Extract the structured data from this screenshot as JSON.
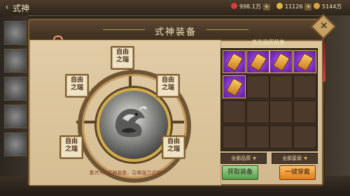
{
  "topbar": {
    "back_icon": "back-arrow-icon",
    "title": "式神",
    "resources": [
      {
        "icon": "jade-icon",
        "color": "#d83b3b",
        "value": "998.1万"
      },
      {
        "icon": "coin-icon",
        "color": "#e2b53a",
        "value": "11126"
      },
      {
        "icon": "stamina-icon",
        "color": "#d9a23b",
        "value": "5144万"
      }
    ]
  },
  "panel": {
    "title": "式神装备",
    "close_icon": "close-icon",
    "slots": [
      {
        "name": "slot-top",
        "label": "自由\n之瑞"
      },
      {
        "name": "slot-upper-left",
        "label": "自由\n之瑞"
      },
      {
        "name": "slot-upper-right",
        "label": "自由\n之瑞"
      },
      {
        "name": "slot-lower-left",
        "label": "自由\n之瑞"
      },
      {
        "name": "slot-lower-right",
        "label": "自由\n之瑞"
      }
    ],
    "hint": "集齐5件式神装备，召唤强力式神",
    "grid_title": "点击选择装备",
    "filled_count": 5,
    "filters": {
      "quality": "全部品质",
      "star": "全部星级"
    },
    "buttons": {
      "obtain": "获取装备",
      "equip_all": "一键穿戴"
    }
  }
}
